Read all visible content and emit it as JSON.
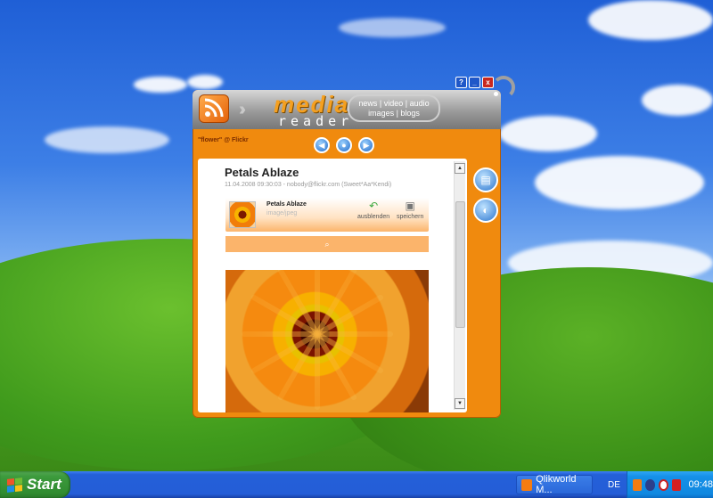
{
  "app": {
    "logo_media": "media",
    "logo_reader": "reader",
    "nav_line1": "news | video | audio",
    "nav_line2": "images | blogs",
    "window_buttons": {
      "help": "?",
      "minimize": "_",
      "close": "x"
    },
    "feed_name": "\"flower\" @ Flickr"
  },
  "post": {
    "title": "Petals Ablaze",
    "meta": "11.04.2008 09:30:03 - nobody@flickr.com (Sweet*Aa*Kendi)",
    "attachment": {
      "title": "Petals Ablaze",
      "type": "image/jpeg",
      "hide_label": "ausblenden",
      "save_label": "speichern"
    },
    "zoom_icon": "magnifier-icon"
  },
  "taskbar": {
    "start_label": "Start",
    "task_label": "Qlikworld M...",
    "language": "DE",
    "clock": "09:48"
  },
  "colors": {
    "accent": "#f08a0e",
    "header_gray": "#9a9a9a",
    "taskbar_blue": "#245dd7",
    "start_green": "#3c9a3c"
  }
}
